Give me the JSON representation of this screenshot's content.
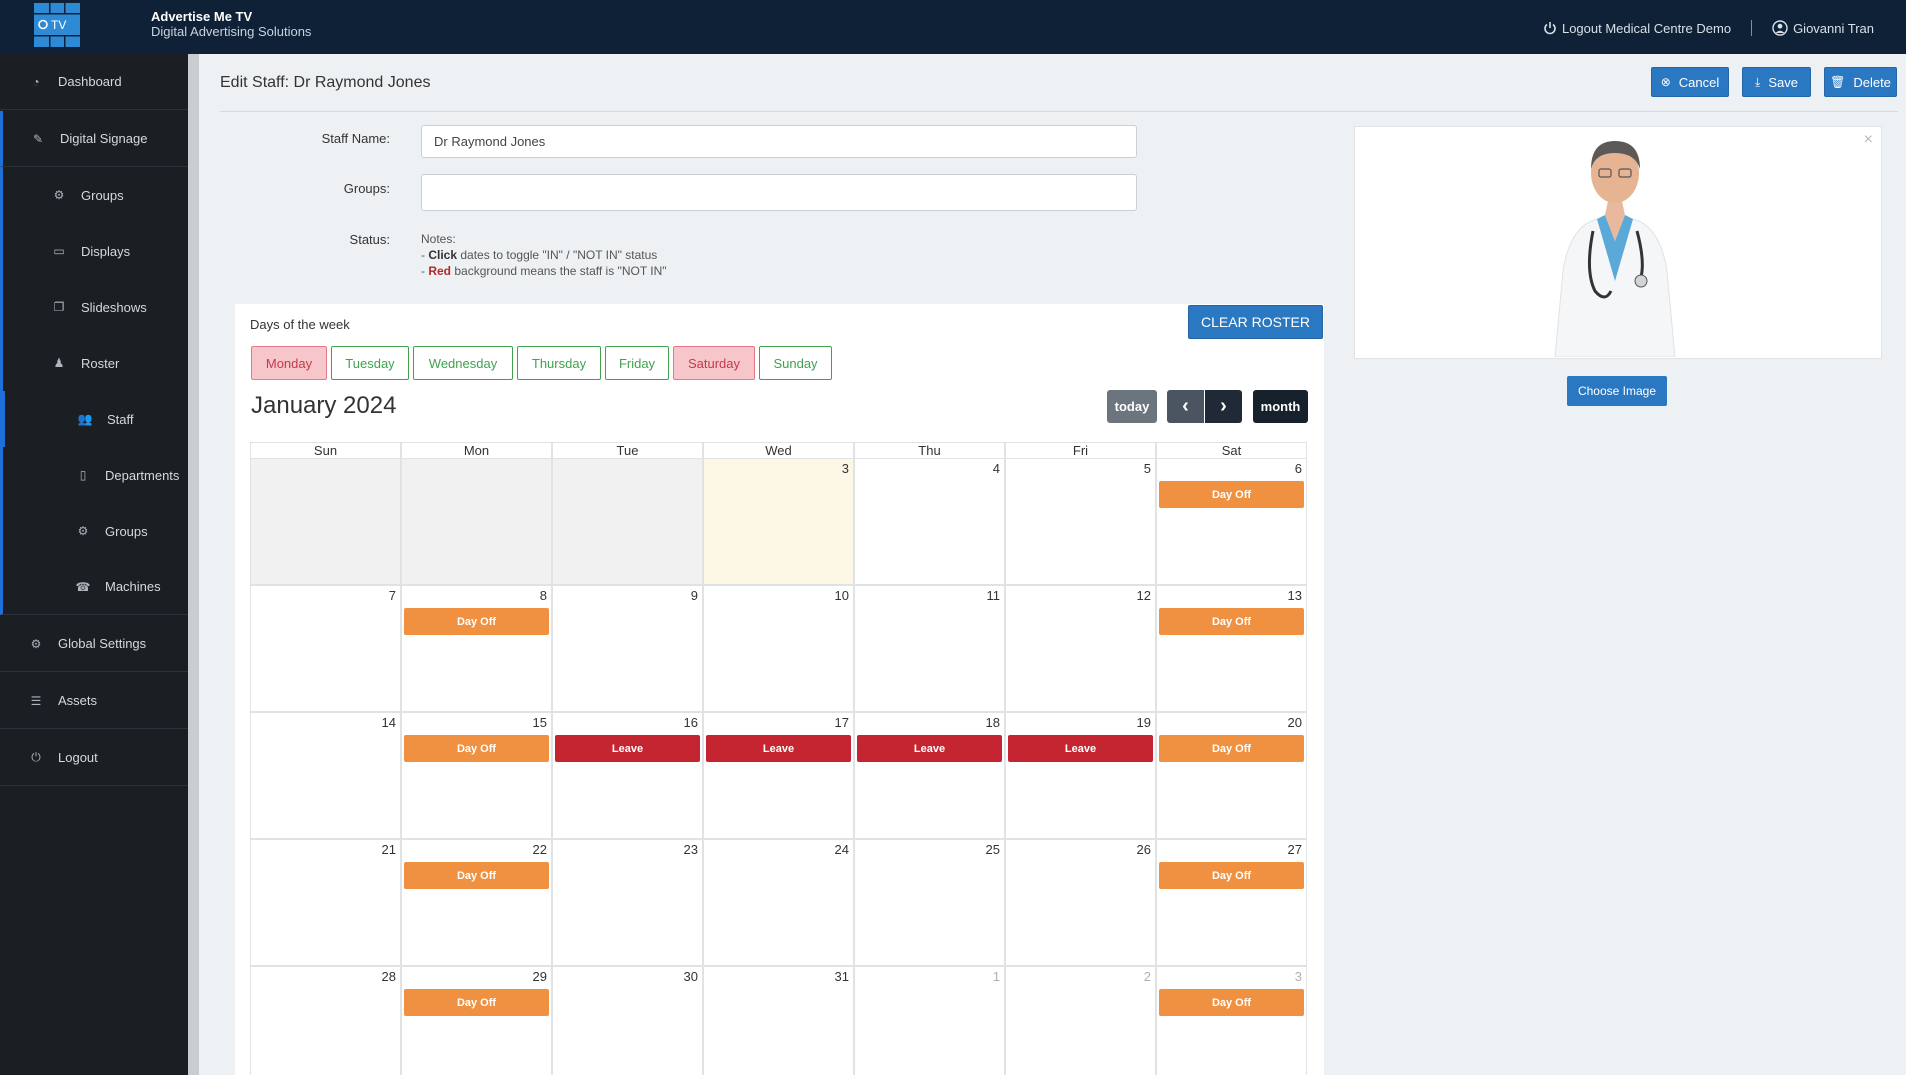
{
  "app": {
    "logo_text": "TV",
    "name": "Advertise Me TV",
    "tagline": "Digital Advertising Solutions",
    "logout_link": "Logout Medical Centre Demo",
    "user_name": "Giovanni Tran"
  },
  "sidebar": {
    "items": [
      {
        "label": "Dashboard",
        "icon": "dashboard-icon"
      },
      {
        "label": "Digital Signage",
        "icon": "signage-icon"
      },
      {
        "label": "Groups",
        "icon": "groups-icon"
      },
      {
        "label": "Displays",
        "icon": "monitor-icon"
      },
      {
        "label": "Slideshows",
        "icon": "slideshow-icon"
      },
      {
        "label": "Roster",
        "icon": "user-icon"
      },
      {
        "label": "Staff",
        "icon": "users-icon"
      },
      {
        "label": "Departments",
        "icon": "building-icon"
      },
      {
        "label": "Groups",
        "icon": "groups-icon"
      },
      {
        "label": "Machines",
        "icon": "machine-icon"
      },
      {
        "label": "Global Settings",
        "icon": "gears-icon"
      },
      {
        "label": "Assets",
        "icon": "database-icon"
      },
      {
        "label": "Logout",
        "icon": "power-icon"
      }
    ]
  },
  "page": {
    "title": "Edit Staff: Dr Raymond Jones",
    "cancel_label": "Cancel",
    "save_label": "Save",
    "delete_label": "Delete"
  },
  "form": {
    "staff_name_label": "Staff Name:",
    "staff_name_value": "Dr Raymond Jones",
    "groups_label": "Groups:",
    "groups_value": "",
    "status_label": "Status:",
    "notes_title": "Notes:",
    "note1_prefix": "- ",
    "note1_bold": "Click",
    "note1_rest": " dates to toggle \"IN\" / \"NOT IN\" status",
    "note2_prefix": "- ",
    "note2_bold": "Red",
    "note2_rest": " background means the staff is \"NOT IN\""
  },
  "photo": {
    "close": "×",
    "choose_label": "Choose Image"
  },
  "roster": {
    "days_label": "Days of the week",
    "clear_label": "CLEAR ROSTER",
    "weekdays": [
      {
        "label": "Monday",
        "off": true
      },
      {
        "label": "Tuesday",
        "off": false
      },
      {
        "label": "Wednesday",
        "off": false
      },
      {
        "label": "Thursday",
        "off": false
      },
      {
        "label": "Friday",
        "off": false
      },
      {
        "label": "Saturday",
        "off": true
      },
      {
        "label": "Sunday",
        "off": false
      }
    ]
  },
  "calendar": {
    "title": "January 2024",
    "today_label": "today",
    "prev": "‹",
    "next": "›",
    "month_label": "month",
    "headers": [
      "Sun",
      "Mon",
      "Tue",
      "Wed",
      "Thu",
      "Fri",
      "Sat"
    ],
    "weeks": [
      [
        {
          "day": "",
          "type": "past"
        },
        {
          "day": "",
          "type": "past"
        },
        {
          "day": "",
          "type": "past"
        },
        {
          "day": "3",
          "type": "today"
        },
        {
          "day": "4"
        },
        {
          "day": "5"
        },
        {
          "day": "6",
          "event": "Day Off"
        }
      ],
      [
        {
          "day": "7"
        },
        {
          "day": "8",
          "event": "Day Off"
        },
        {
          "day": "9"
        },
        {
          "day": "10"
        },
        {
          "day": "11"
        },
        {
          "day": "12"
        },
        {
          "day": "13",
          "event": "Day Off"
        }
      ],
      [
        {
          "day": "14"
        },
        {
          "day": "15",
          "event": "Day Off"
        },
        {
          "day": "16",
          "event": "Leave"
        },
        {
          "day": "17",
          "event": "Leave"
        },
        {
          "day": "18",
          "event": "Leave"
        },
        {
          "day": "19",
          "event": "Leave"
        },
        {
          "day": "20",
          "event": "Day Off"
        }
      ],
      [
        {
          "day": "21"
        },
        {
          "day": "22",
          "event": "Day Off"
        },
        {
          "day": "23"
        },
        {
          "day": "24"
        },
        {
          "day": "25"
        },
        {
          "day": "26"
        },
        {
          "day": "27",
          "event": "Day Off"
        }
      ],
      [
        {
          "day": "28"
        },
        {
          "day": "29",
          "event": "Day Off"
        },
        {
          "day": "30"
        },
        {
          "day": "31"
        },
        {
          "day": "1",
          "type": "other"
        },
        {
          "day": "2",
          "type": "other"
        },
        {
          "day": "3",
          "type": "other",
          "event": "Day Off"
        }
      ]
    ]
  },
  "colors": {
    "topbar": "#0e2136",
    "sidebar": "#1b1f23",
    "primary": "#2b78c2",
    "day_off": "#ef9140",
    "leave": "#c42530",
    "today": "#fcf8e5"
  }
}
